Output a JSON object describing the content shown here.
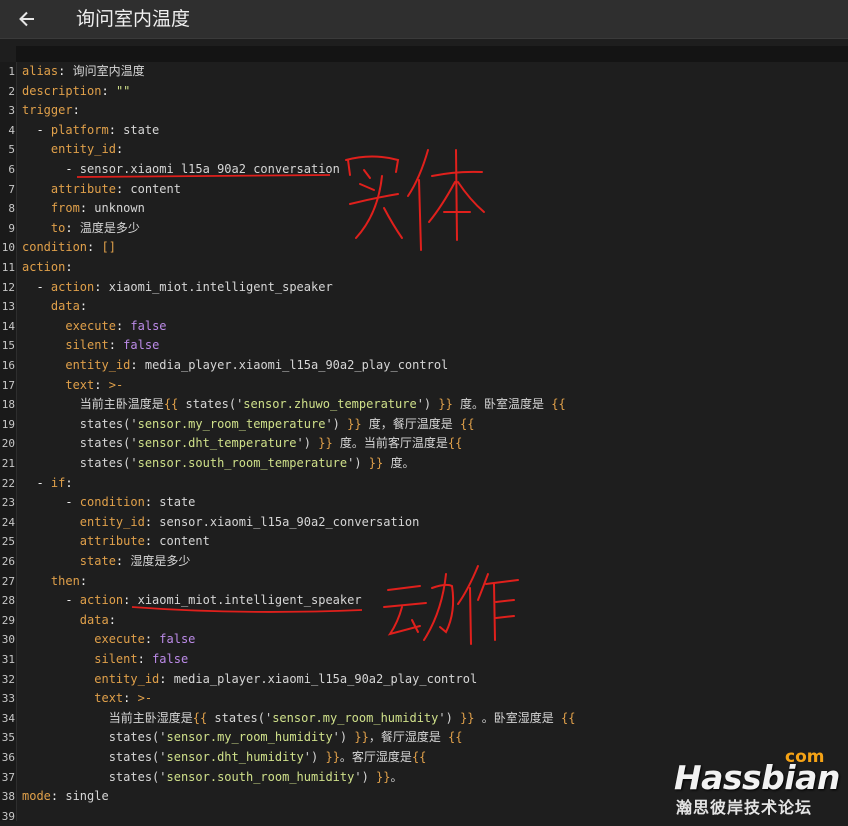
{
  "header": {
    "title": "询问室内温度",
    "back_icon": "arrow-left-icon"
  },
  "colors": {
    "key": "#e0a04a",
    "value": "#d6d6d6",
    "boolean": "#bc8be8",
    "string": "#cfe08a",
    "annotation": "#e0201c",
    "brand_accent": "#f5a316"
  },
  "code_lines": [
    {
      "num": "1",
      "seg": [
        {
          "c": "k",
          "t": "alias"
        },
        {
          "c": "p",
          "t": ": "
        },
        {
          "c": "v",
          "t": "询问室内温度"
        }
      ]
    },
    {
      "num": "2",
      "seg": [
        {
          "c": "k",
          "t": "description"
        },
        {
          "c": "p",
          "t": ": "
        },
        {
          "c": "s",
          "t": "\"\""
        }
      ]
    },
    {
      "num": "3",
      "seg": [
        {
          "c": "k",
          "t": "trigger"
        },
        {
          "c": "p",
          "t": ":"
        }
      ]
    },
    {
      "num": "4",
      "seg": [
        {
          "c": "p",
          "t": "  - "
        },
        {
          "c": "k",
          "t": "platform"
        },
        {
          "c": "p",
          "t": ": "
        },
        {
          "c": "v",
          "t": "state"
        }
      ]
    },
    {
      "num": "5",
      "seg": [
        {
          "c": "p",
          "t": "    "
        },
        {
          "c": "k",
          "t": "entity_id"
        },
        {
          "c": "p",
          "t": ":"
        }
      ]
    },
    {
      "num": "6",
      "seg": [
        {
          "c": "p",
          "t": "      - "
        },
        {
          "c": "v",
          "t": "sensor.xiaomi_l15a_90a2_conversation"
        }
      ]
    },
    {
      "num": "7",
      "seg": [
        {
          "c": "p",
          "t": "    "
        },
        {
          "c": "k",
          "t": "attribute"
        },
        {
          "c": "p",
          "t": ": "
        },
        {
          "c": "v",
          "t": "content"
        }
      ]
    },
    {
      "num": "8",
      "seg": [
        {
          "c": "p",
          "t": "    "
        },
        {
          "c": "k",
          "t": "from"
        },
        {
          "c": "p",
          "t": ": "
        },
        {
          "c": "v",
          "t": "unknown"
        }
      ]
    },
    {
      "num": "9",
      "seg": [
        {
          "c": "p",
          "t": "    "
        },
        {
          "c": "k",
          "t": "to"
        },
        {
          "c": "p",
          "t": ": "
        },
        {
          "c": "v",
          "t": "温度是多少"
        }
      ]
    },
    {
      "num": "10",
      "seg": [
        {
          "c": "k",
          "t": "condition"
        },
        {
          "c": "p",
          "t": ": "
        },
        {
          "c": "t",
          "t": "[]"
        }
      ]
    },
    {
      "num": "11",
      "seg": [
        {
          "c": "k",
          "t": "action"
        },
        {
          "c": "p",
          "t": ":"
        }
      ]
    },
    {
      "num": "12",
      "seg": [
        {
          "c": "p",
          "t": "  - "
        },
        {
          "c": "k",
          "t": "action"
        },
        {
          "c": "p",
          "t": ": "
        },
        {
          "c": "v",
          "t": "xiaomi_miot.intelligent_speaker"
        }
      ]
    },
    {
      "num": "13",
      "seg": [
        {
          "c": "p",
          "t": "    "
        },
        {
          "c": "k",
          "t": "data"
        },
        {
          "c": "p",
          "t": ":"
        }
      ]
    },
    {
      "num": "14",
      "seg": [
        {
          "c": "p",
          "t": "      "
        },
        {
          "c": "k",
          "t": "execute"
        },
        {
          "c": "p",
          "t": ": "
        },
        {
          "c": "b",
          "t": "false"
        }
      ]
    },
    {
      "num": "15",
      "seg": [
        {
          "c": "p",
          "t": "      "
        },
        {
          "c": "k",
          "t": "silent"
        },
        {
          "c": "p",
          "t": ": "
        },
        {
          "c": "b",
          "t": "false"
        }
      ]
    },
    {
      "num": "16",
      "seg": [
        {
          "c": "p",
          "t": "      "
        },
        {
          "c": "k",
          "t": "entity_id"
        },
        {
          "c": "p",
          "t": ": "
        },
        {
          "c": "v",
          "t": "media_player.xiaomi_l15a_90a2_play_control"
        }
      ]
    },
    {
      "num": "17",
      "seg": [
        {
          "c": "p",
          "t": "      "
        },
        {
          "c": "k",
          "t": "text"
        },
        {
          "c": "p",
          "t": ": "
        },
        {
          "c": "t",
          "t": ">-"
        }
      ]
    },
    {
      "num": "18",
      "seg": [
        {
          "c": "p",
          "t": "        "
        },
        {
          "c": "v",
          "t": "当前主卧温度是"
        },
        {
          "c": "t",
          "t": "{{ "
        },
        {
          "c": "v",
          "t": "states('"
        },
        {
          "c": "s",
          "t": "sensor.zhuwo_temperature"
        },
        {
          "c": "v",
          "t": "') "
        },
        {
          "c": "t",
          "t": "}}"
        },
        {
          "c": "v",
          "t": " 度。卧室温度是 "
        },
        {
          "c": "t",
          "t": "{{"
        }
      ]
    },
    {
      "num": "19",
      "seg": [
        {
          "c": "p",
          "t": "        "
        },
        {
          "c": "v",
          "t": "states('"
        },
        {
          "c": "s",
          "t": "sensor.my_room_temperature"
        },
        {
          "c": "v",
          "t": "') "
        },
        {
          "c": "t",
          "t": "}}"
        },
        {
          "c": "v",
          "t": " 度，餐厅温度是 "
        },
        {
          "c": "t",
          "t": "{{"
        }
      ]
    },
    {
      "num": "20",
      "seg": [
        {
          "c": "p",
          "t": "        "
        },
        {
          "c": "v",
          "t": "states('"
        },
        {
          "c": "s",
          "t": "sensor.dht_temperature"
        },
        {
          "c": "v",
          "t": "') "
        },
        {
          "c": "t",
          "t": "}}"
        },
        {
          "c": "v",
          "t": " 度。当前客厅温度是"
        },
        {
          "c": "t",
          "t": "{{"
        }
      ]
    },
    {
      "num": "21",
      "seg": [
        {
          "c": "p",
          "t": "        "
        },
        {
          "c": "v",
          "t": "states('"
        },
        {
          "c": "s",
          "t": "sensor.south_room_temperature"
        },
        {
          "c": "v",
          "t": "') "
        },
        {
          "c": "t",
          "t": "}}"
        },
        {
          "c": "v",
          "t": " 度。"
        }
      ]
    },
    {
      "num": "22",
      "seg": [
        {
          "c": "p",
          "t": "  - "
        },
        {
          "c": "k",
          "t": "if"
        },
        {
          "c": "p",
          "t": ":"
        }
      ]
    },
    {
      "num": "23",
      "seg": [
        {
          "c": "p",
          "t": "      - "
        },
        {
          "c": "k",
          "t": "condition"
        },
        {
          "c": "p",
          "t": ": "
        },
        {
          "c": "v",
          "t": "state"
        }
      ]
    },
    {
      "num": "24",
      "seg": [
        {
          "c": "p",
          "t": "        "
        },
        {
          "c": "k",
          "t": "entity_id"
        },
        {
          "c": "p",
          "t": ": "
        },
        {
          "c": "v",
          "t": "sensor.xiaomi_l15a_90a2_conversation"
        }
      ]
    },
    {
      "num": "25",
      "seg": [
        {
          "c": "p",
          "t": "        "
        },
        {
          "c": "k",
          "t": "attribute"
        },
        {
          "c": "p",
          "t": ": "
        },
        {
          "c": "v",
          "t": "content"
        }
      ]
    },
    {
      "num": "26",
      "seg": [
        {
          "c": "p",
          "t": "        "
        },
        {
          "c": "k",
          "t": "state"
        },
        {
          "c": "p",
          "t": ": "
        },
        {
          "c": "v",
          "t": "湿度是多少"
        }
      ]
    },
    {
      "num": "27",
      "seg": [
        {
          "c": "p",
          "t": "    "
        },
        {
          "c": "k",
          "t": "then"
        },
        {
          "c": "p",
          "t": ":"
        }
      ]
    },
    {
      "num": "28",
      "seg": [
        {
          "c": "p",
          "t": "      - "
        },
        {
          "c": "k",
          "t": "action"
        },
        {
          "c": "p",
          "t": ": "
        },
        {
          "c": "v",
          "t": "xiaomi_miot.intelligent_speaker"
        }
      ]
    },
    {
      "num": "29",
      "seg": [
        {
          "c": "p",
          "t": "        "
        },
        {
          "c": "k",
          "t": "data"
        },
        {
          "c": "p",
          "t": ":"
        }
      ]
    },
    {
      "num": "30",
      "seg": [
        {
          "c": "p",
          "t": "          "
        },
        {
          "c": "k",
          "t": "execute"
        },
        {
          "c": "p",
          "t": ": "
        },
        {
          "c": "b",
          "t": "false"
        }
      ]
    },
    {
      "num": "31",
      "seg": [
        {
          "c": "p",
          "t": "          "
        },
        {
          "c": "k",
          "t": "silent"
        },
        {
          "c": "p",
          "t": ": "
        },
        {
          "c": "b",
          "t": "false"
        }
      ]
    },
    {
      "num": "32",
      "seg": [
        {
          "c": "p",
          "t": "          "
        },
        {
          "c": "k",
          "t": "entity_id"
        },
        {
          "c": "p",
          "t": ": "
        },
        {
          "c": "v",
          "t": "media_player.xiaomi_l15a_90a2_play_control"
        }
      ]
    },
    {
      "num": "33",
      "seg": [
        {
          "c": "p",
          "t": "          "
        },
        {
          "c": "k",
          "t": "text"
        },
        {
          "c": "p",
          "t": ": "
        },
        {
          "c": "t",
          "t": ">-"
        }
      ]
    },
    {
      "num": "34",
      "seg": [
        {
          "c": "p",
          "t": "            "
        },
        {
          "c": "v",
          "t": "当前主卧湿度是"
        },
        {
          "c": "t",
          "t": "{{ "
        },
        {
          "c": "v",
          "t": "states('"
        },
        {
          "c": "s",
          "t": "sensor.my_room_humidity"
        },
        {
          "c": "v",
          "t": "') "
        },
        {
          "c": "t",
          "t": "}}"
        },
        {
          "c": "v",
          "t": " 。卧室湿度是 "
        },
        {
          "c": "t",
          "t": "{{"
        }
      ]
    },
    {
      "num": "35",
      "seg": [
        {
          "c": "p",
          "t": "            "
        },
        {
          "c": "v",
          "t": "states('"
        },
        {
          "c": "s",
          "t": "sensor.my_room_humidity"
        },
        {
          "c": "v",
          "t": "') "
        },
        {
          "c": "t",
          "t": "}}"
        },
        {
          "c": "v",
          "t": "，餐厅湿度是 "
        },
        {
          "c": "t",
          "t": "{{"
        }
      ]
    },
    {
      "num": "36",
      "seg": [
        {
          "c": "p",
          "t": "            "
        },
        {
          "c": "v",
          "t": "states('"
        },
        {
          "c": "s",
          "t": "sensor.dht_humidity"
        },
        {
          "c": "v",
          "t": "') "
        },
        {
          "c": "t",
          "t": "}}"
        },
        {
          "c": "v",
          "t": "。客厅湿度是"
        },
        {
          "c": "t",
          "t": "{{"
        }
      ]
    },
    {
      "num": "37",
      "seg": [
        {
          "c": "p",
          "t": "            "
        },
        {
          "c": "v",
          "t": "states('"
        },
        {
          "c": "s",
          "t": "sensor.south_room_humidity"
        },
        {
          "c": "v",
          "t": "') "
        },
        {
          "c": "t",
          "t": "}}"
        },
        {
          "c": "v",
          "t": "。"
        }
      ]
    },
    {
      "num": "38",
      "seg": [
        {
          "c": "k",
          "t": "mode"
        },
        {
          "c": "p",
          "t": ": "
        },
        {
          "c": "v",
          "t": "single"
        }
      ]
    },
    {
      "num": "39",
      "seg": []
    }
  ],
  "annotations": {
    "entity_label": "实体",
    "action_label": "动作"
  },
  "watermark": {
    "com": "com",
    "brand": "Hassbian",
    "subtitle": "瀚思彼岸技术论坛"
  }
}
